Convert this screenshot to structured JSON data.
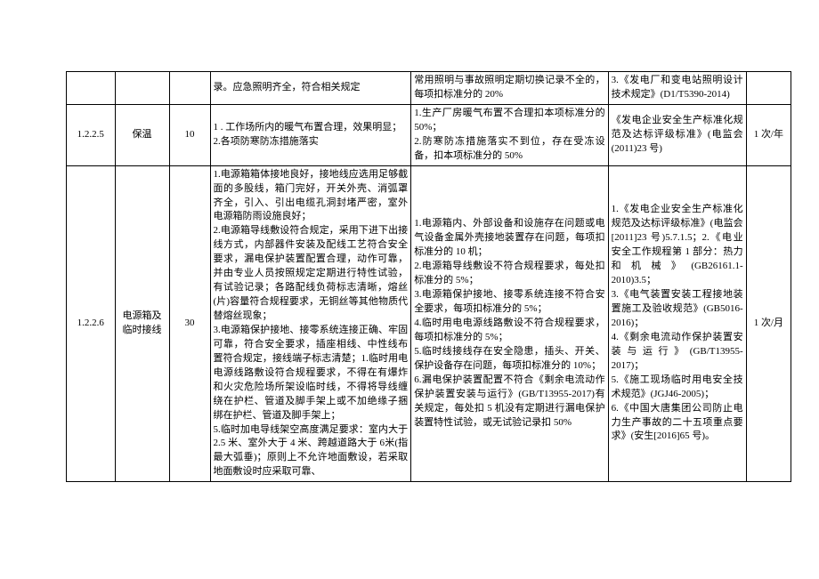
{
  "rows": [
    {
      "col1": "",
      "col2": "",
      "col3": "",
      "col4": "录。应急照明齐全，符合相关规定",
      "col5": "常用照明与事故照明定期切换记录不全的，每项扣标准分的 20%",
      "col6": "3.《发电厂和变电站照明设计技术规定》(D1/T5390-2014)",
      "col7": ""
    },
    {
      "col1": "1.2.2.5",
      "col2": "保温",
      "col3": "10",
      "col4": "1 . 工作场所内的暖气布置合理，效果明显；\n2.各项防寒防冻措施落实",
      "col5": "1.生产厂房暖气布置不合理扣本项标准分的50%；\n2.防寒防冻措施落实不到位，存在受冻设备，扣本项标准分的 50%",
      "col6": "《发电企业安全生产标准化规范及达标评级标准》(电监会 (2011)23 号)",
      "col7": "1 次/年"
    },
    {
      "col1": "1.2.2.6",
      "col2": "电源箱及临时接线",
      "col3": "30",
      "col4": "1.电源箱箱体接地良好，接地线应选用足够截面的多股线，箱门完好，开关外壳、消弧罩齐全，引入、引出电缆孔洞封堵严密，室外电源箱防雨设施良好；\n2.电源箱导线敷设符合规定，采用下进下出接线方式，内部器件安装及配线工艺符合安全要求，漏电保护装置配置合理，动作可靠，并由专业人员按照规定定期进行特性试验，有试验记录；各路配线负荷标志清晰，熔丝(片)容量符合规程要求，无铜丝等其他物质代替熔丝现象；\n3.电源箱保护接地、接零系统连接正确、牢固可靠，符合安全要求，插座相线、中性线布置符合规定，接线端子标志清楚；1.临时用电电源线路敷设符合规程要求，不得在有爆炸和火灾危险场所架设临时线，不得将导线缠绕在护栏、管道及脚手架上或不加绝缘子捆绑在护栏、管道及脚手架上；\n5.临时加电导线架空高度满足要求：室内大于 2.5 米、室外大于 4 米、跨越道路大于 6米(指最大弧垂)；原则上不允许地面敷设，若采取地面敷设时应采取可靠、",
      "col5": "1.电源箱内、外部设备和设施存在问题或电气设备金属外壳接地装置存在问题，每项扣标准分的 10 机；\n2.电源箱导线敷设不符合规程要求，每处扣标准分的 5%；\n3.电源箱保护接地、接零系统连接不符合安全要求，每项扣标准分的 5%；\n4.临时用电电源线路敷设不符合规程要求，每项扣标准分的 5%；\n5.临时线接线存在安全隐患，插头、开关、保护设备存在问题，每项扣标准分的 10%；\n6.漏电保护装置配置不符合《剩余电流动作保护装置安装与运行》(GB/T13955-2017)有关规定，每处扣 5 机没有定期进行漏电保护装置特性试验，或无试验记录扣 50%",
      "col6": "1.《发电企业安全生产标准化规范及达标评级标准》(电监会[2011]23 号)5.7.1.5；2.《电业安全工作规程第 1 部分：热力 和 机 械 》 (GB26161.1-2010)3.5；\n3.《电气装置安装工程接地装置施工及验收规范》(GB5016-2016)；\n4.《剩余电流动作保护装置安装与运行》(GB/T13955-2017)；\n5.《施工现场临时用电安全技术规范》(JGJ46-2005)；\n6.《中国大唐集团公司防止电力生产事故的二十五项重点要求》(安生[2016]65 号)。",
      "col7": "1 次/月"
    }
  ]
}
